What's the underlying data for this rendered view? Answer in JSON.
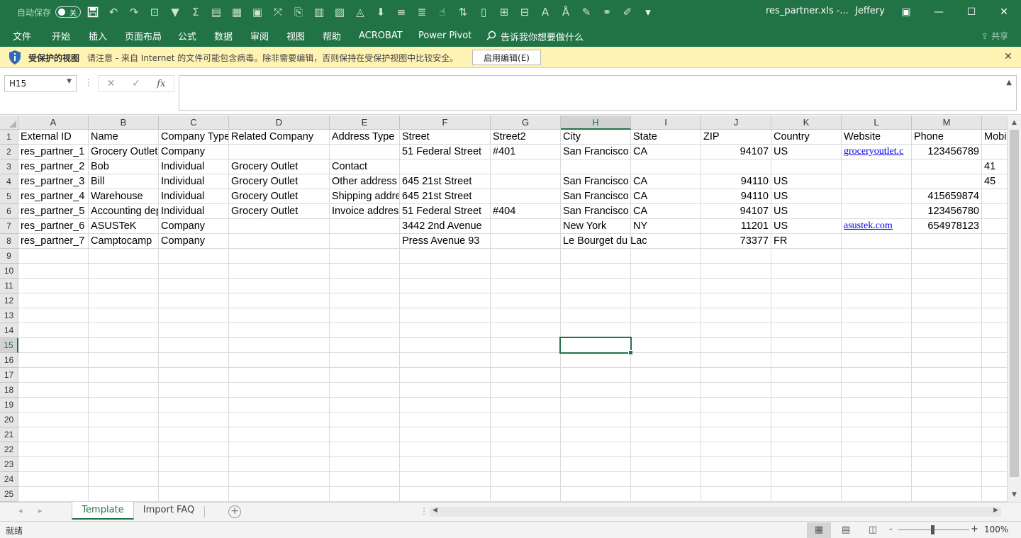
{
  "titlebar": {
    "autosave_label": "自动保存",
    "autosave_state": "关",
    "document_title": "res_partner.xls  -...",
    "user_name": "Jeffery"
  },
  "ribbon": {
    "tabs": [
      "文件",
      "开始",
      "插入",
      "页面布局",
      "公式",
      "数据",
      "审阅",
      "视图",
      "帮助",
      "ACROBAT",
      "Power Pivot"
    ],
    "tell_me": "告诉我你想要做什么",
    "share": "共享"
  },
  "protected_view": {
    "title": "受保护的视图",
    "message": "请注意 - 来自 Internet 的文件可能包含病毒。除非需要编辑，否则保持在受保护视图中比较安全。",
    "enable_button": "启用编辑(E)"
  },
  "formula_bar": {
    "name_box": "H15",
    "cancel_icon": "✕",
    "enter_icon": "✓",
    "fx_label": "fx",
    "content": ""
  },
  "sheet": {
    "columns": [
      "A",
      "B",
      "C",
      "D",
      "E",
      "F",
      "G",
      "H",
      "I",
      "J",
      "K",
      "L",
      "M",
      "N"
    ],
    "selected_column": "H",
    "selected_row": "15",
    "row_numbers": [
      "1",
      "2",
      "3",
      "4",
      "5",
      "6",
      "7",
      "8",
      "9",
      "10",
      "11",
      "12",
      "13",
      "14",
      "15",
      "16",
      "17",
      "18",
      "19",
      "20",
      "21",
      "22",
      "23",
      "24",
      "25"
    ],
    "rows": [
      [
        "External ID",
        "Name",
        "Company Type",
        "Related Company",
        "Address Type",
        "Street",
        "Street2",
        "City",
        "State",
        "ZIP",
        "Country",
        "Website",
        "Phone",
        "Mobi"
      ],
      [
        "res_partner_1",
        "Grocery Outlet",
        "Company",
        "",
        "",
        "51 Federal Street",
        "#401",
        "San Francisco",
        "CA",
        "94107",
        "US",
        "groceryoutlet.c",
        "123456789",
        ""
      ],
      [
        "res_partner_2",
        "Bob",
        "Individual",
        "Grocery Outlet",
        "Contact",
        "",
        "",
        "",
        "",
        "",
        "",
        "",
        "",
        "41"
      ],
      [
        "res_partner_3",
        "Bill",
        "Individual",
        "Grocery Outlet",
        "Other address",
        "645 21st Street",
        "",
        "San Francisco",
        "CA",
        "94110",
        "US",
        "",
        "",
        "45"
      ],
      [
        "res_partner_4",
        "Warehouse",
        "Individual",
        "Grocery Outlet",
        "Shipping address",
        "645 21st Street",
        "",
        "San Francisco",
        "CA",
        "94110",
        "US",
        "",
        "415659874",
        ""
      ],
      [
        "res_partner_5",
        "Accounting department",
        "Individual",
        "Grocery Outlet",
        "Invoice address",
        "51 Federal Street",
        "#404",
        "San Francisco",
        "CA",
        "94107",
        "US",
        "",
        "123456780",
        ""
      ],
      [
        "res_partner_6",
        "ASUSTeK",
        "Company",
        "",
        "",
        "3442 2nd Avenue",
        "",
        "New York",
        "NY",
        "11201",
        "US",
        "asustek.com",
        "654978123",
        ""
      ],
      [
        "res_partner_7",
        "Camptocamp",
        "Company",
        "",
        "",
        "Press Avenue 93",
        "",
        "Le Bourget du Lac",
        "",
        "73377",
        "FR",
        "",
        "",
        ""
      ]
    ]
  },
  "sheet_tabs": {
    "tabs": [
      "Template",
      "Import FAQ"
    ],
    "active": "Template",
    "add_sheet": "+"
  },
  "statusbar": {
    "status": "就绪",
    "zoom": "100%",
    "zoom_minus": "-",
    "zoom_plus": "+"
  },
  "colors": {
    "excel_green": "#217346",
    "protected_bar": "#fff3b4",
    "link": "#0000ee"
  }
}
